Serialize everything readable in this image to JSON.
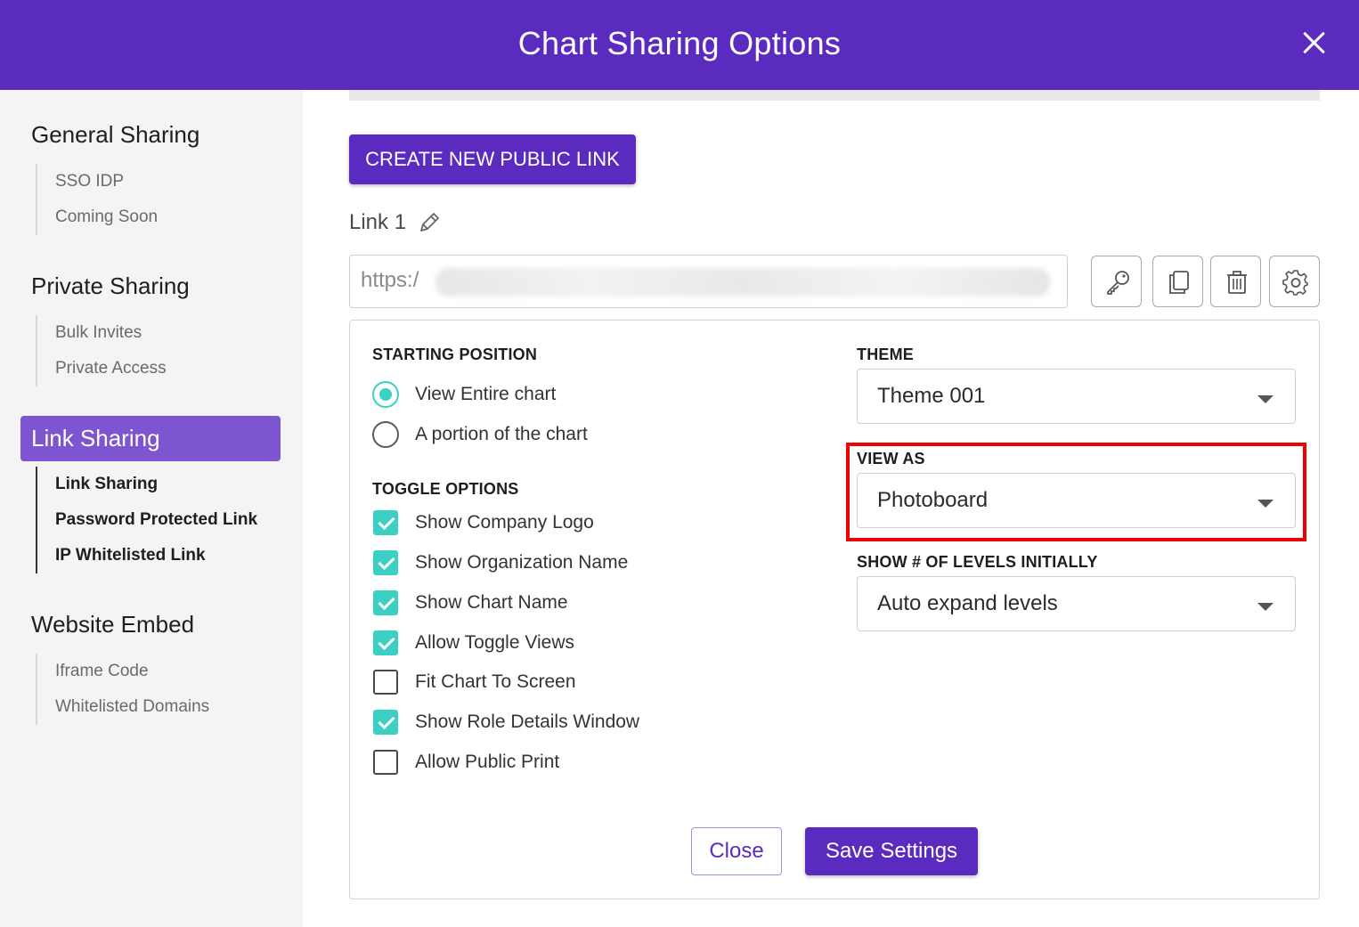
{
  "header": {
    "title": "Chart Sharing Options",
    "close_icon": "close-icon"
  },
  "sidebar": {
    "groups": [
      {
        "title": "General Sharing",
        "items": [
          "SSO IDP",
          "Coming Soon"
        ]
      },
      {
        "title": "Private Sharing",
        "items": [
          "Bulk Invites",
          "Private Access"
        ]
      },
      {
        "title": "Link Sharing",
        "active": true,
        "items": [
          "Link Sharing",
          "Password Protected Link",
          "IP Whitelisted Link"
        ]
      },
      {
        "title": "Website Embed",
        "items": [
          "Iframe Code",
          "Whitelisted Domains"
        ]
      }
    ]
  },
  "main": {
    "create_button": "CREATE NEW PUBLIC LINK",
    "link": {
      "name": "Link 1",
      "url_prefix": "https:/",
      "actions": [
        "key-icon",
        "copy-icon",
        "trash-icon",
        "gear-icon"
      ]
    },
    "starting_position": {
      "label": "STARTING POSITION",
      "options": [
        {
          "label": "View Entire chart",
          "selected": true
        },
        {
          "label": "A portion of the chart",
          "selected": false
        }
      ]
    },
    "toggle_options": {
      "label": "TOGGLE OPTIONS",
      "items": [
        {
          "label": "Show Company Logo",
          "checked": true
        },
        {
          "label": "Show Organization Name",
          "checked": true
        },
        {
          "label": "Show Chart Name",
          "checked": true
        },
        {
          "label": "Allow Toggle Views",
          "checked": true
        },
        {
          "label": "Fit Chart To Screen",
          "checked": false
        },
        {
          "label": "Show Role Details Window",
          "checked": true
        },
        {
          "label": "Allow Public Print",
          "checked": false
        }
      ]
    },
    "theme": {
      "label": "THEME",
      "value": "Theme 001"
    },
    "view_as": {
      "label": "VIEW AS",
      "value": "Photoboard"
    },
    "levels": {
      "label": "SHOW # OF LEVELS INITIALLY",
      "value": "Auto expand levels"
    },
    "footer": {
      "close": "Close",
      "save": "Save Settings"
    }
  },
  "colors": {
    "primary": "#5b2bc0",
    "accent": "#3bd0c3",
    "highlight": "#f00000",
    "active_sidebar": "#7e55d0"
  }
}
